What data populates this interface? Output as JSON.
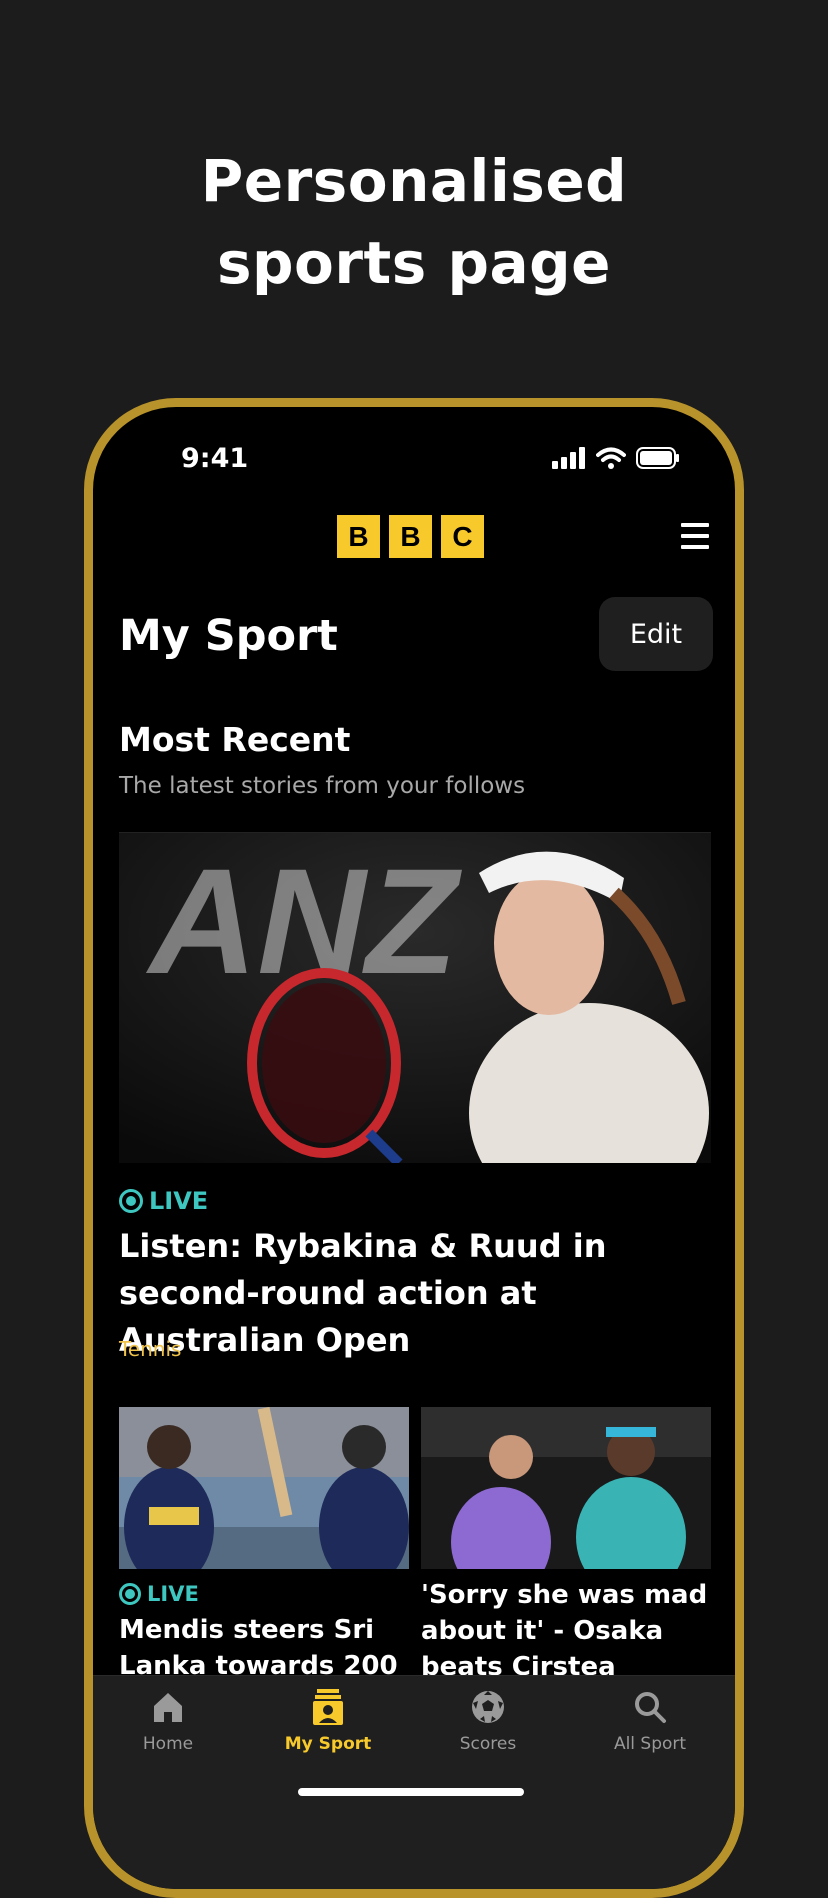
{
  "promo": {
    "title_line1": "Personalised",
    "title_line2": "sports page"
  },
  "status_bar": {
    "time": "9:41"
  },
  "header": {
    "logo_letters": [
      "B",
      "B",
      "C"
    ]
  },
  "page": {
    "title": "My Sport",
    "edit_label": "Edit"
  },
  "section": {
    "title": "Most Recent",
    "subtitle": "The latest stories from your follows"
  },
  "lead_story": {
    "live_label": "LIVE",
    "headline": "Listen: Rybakina & Ruud in second-round action at Australian Open",
    "tag": "Tennis"
  },
  "cards": [
    {
      "live_label": "LIVE",
      "headline": "Mendis steers Sri Lanka towards 200"
    },
    {
      "headline": "'Sorry she was mad about it' - Osaka beats Cirstea"
    }
  ],
  "tabs": [
    {
      "label": "Home",
      "icon": "home-icon"
    },
    {
      "label": "My Sport",
      "icon": "my-sport-icon"
    },
    {
      "label": "Scores",
      "icon": "football-icon"
    },
    {
      "label": "All Sport",
      "icon": "search-icon"
    }
  ],
  "colors": {
    "accent": "#f8c92b",
    "live": "#3ec7c0",
    "frame": "#b8922a",
    "tag": "#f0c44a"
  }
}
